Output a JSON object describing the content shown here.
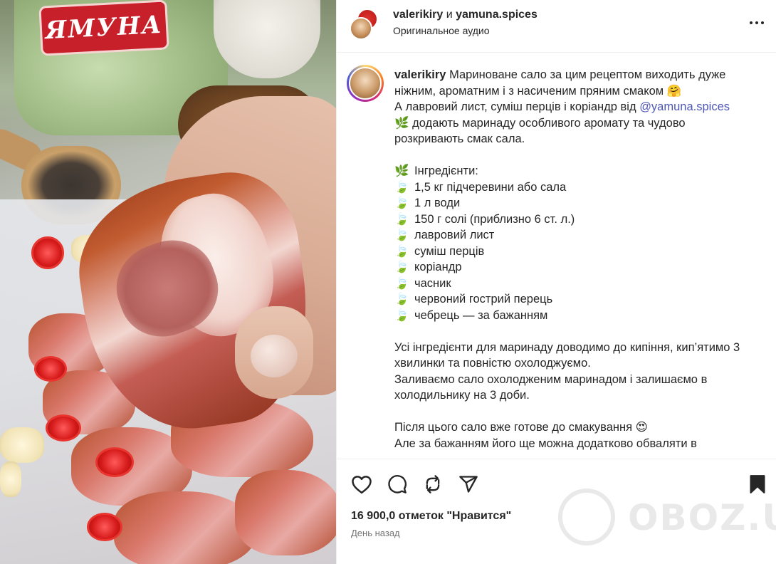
{
  "header": {
    "username": "valerikiry",
    "separator": "и",
    "collaborator": "yamuna.spices",
    "audio": "Оригинальное аудио"
  },
  "media": {
    "brand_logo_text": "ЯМУНА"
  },
  "caption": {
    "username": "valerikiry",
    "intro": "Мариноване сало за цим рецептом виходить дуже ніжним, ароматним і з насиченим пряним смаком 🤗",
    "line2_prefix": "А лавровий лист, суміш перців і коріандр від ",
    "mention": "@yamuna.spices",
    "line3_icon": "🌿",
    "line3_text": "додають маринаду особливого аромату та чудово розкривають смак сала.",
    "ingredients_icon": "🌿",
    "ingredients_title": "Інгредієнти:",
    "item_icon": "🍃",
    "ingredients": [
      "1,5 кг підчеревини або сала",
      "1 л води",
      "150 г солі (приблизно 6 ст. л.)",
      "лавровий лист",
      "суміш перців",
      "коріандр",
      "часник",
      "червоний гострий перець",
      "чебрець — за бажанням"
    ],
    "step1": "Усі інгредієнти для маринаду доводимо до кипіння, кип’ятимо 3 хвилинки та повністю охолоджуємо.",
    "step2": "Заливаємо сало охолодженим маринадом і залишаємо в холодильнику на 3 доби.",
    "step3": "Після цього сало вже готове до смакування 😍",
    "step4": "Але за бажанням його ще можна додатково обваляти в"
  },
  "actions": {
    "likes": "16 900,0 отметок \"Нравится\"",
    "time": "День назад"
  },
  "watermark": {
    "text": "OBOZ.UA"
  }
}
